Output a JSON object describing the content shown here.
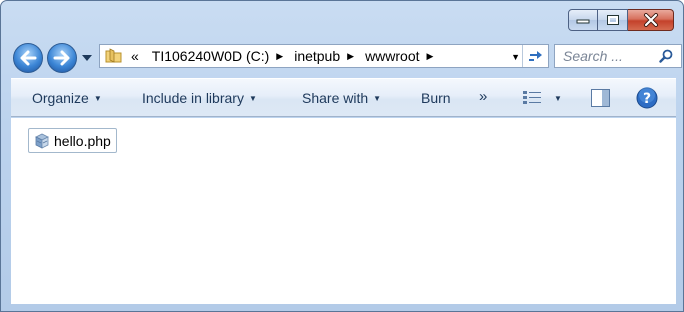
{
  "window": {
    "caption": {
      "minimize_glyph": "—",
      "maximize_glyph": "□",
      "close_glyph": "✕"
    }
  },
  "navigation": {
    "back_icon": "arrow-left-icon",
    "forward_icon": "arrow-right-icon",
    "recent_pages_icon": "chevron-down-icon"
  },
  "address_bar": {
    "overflow": "«",
    "crumbs": [
      {
        "label": "TI106240W0D (C:)"
      },
      {
        "label": "inetpub"
      },
      {
        "label": "wwwroot"
      }
    ],
    "refresh_icon": "refresh-icon"
  },
  "search": {
    "placeholder": "Search ..."
  },
  "toolbar": {
    "organize": "Organize",
    "include_in_library": "Include in library",
    "share_with": "Share with",
    "burn": "Burn",
    "more": "»",
    "views_icon": "details-view-icon",
    "preview_icon": "preview-pane-icon",
    "help_icon": "help-icon"
  },
  "files": [
    {
      "name": "hello.php",
      "icon": "php-file-icon"
    }
  ],
  "colors": {
    "frame": "#bcd3ee",
    "toolbar": "#dde8f5",
    "close_button": "#c4412b",
    "text": "#1e395b"
  }
}
